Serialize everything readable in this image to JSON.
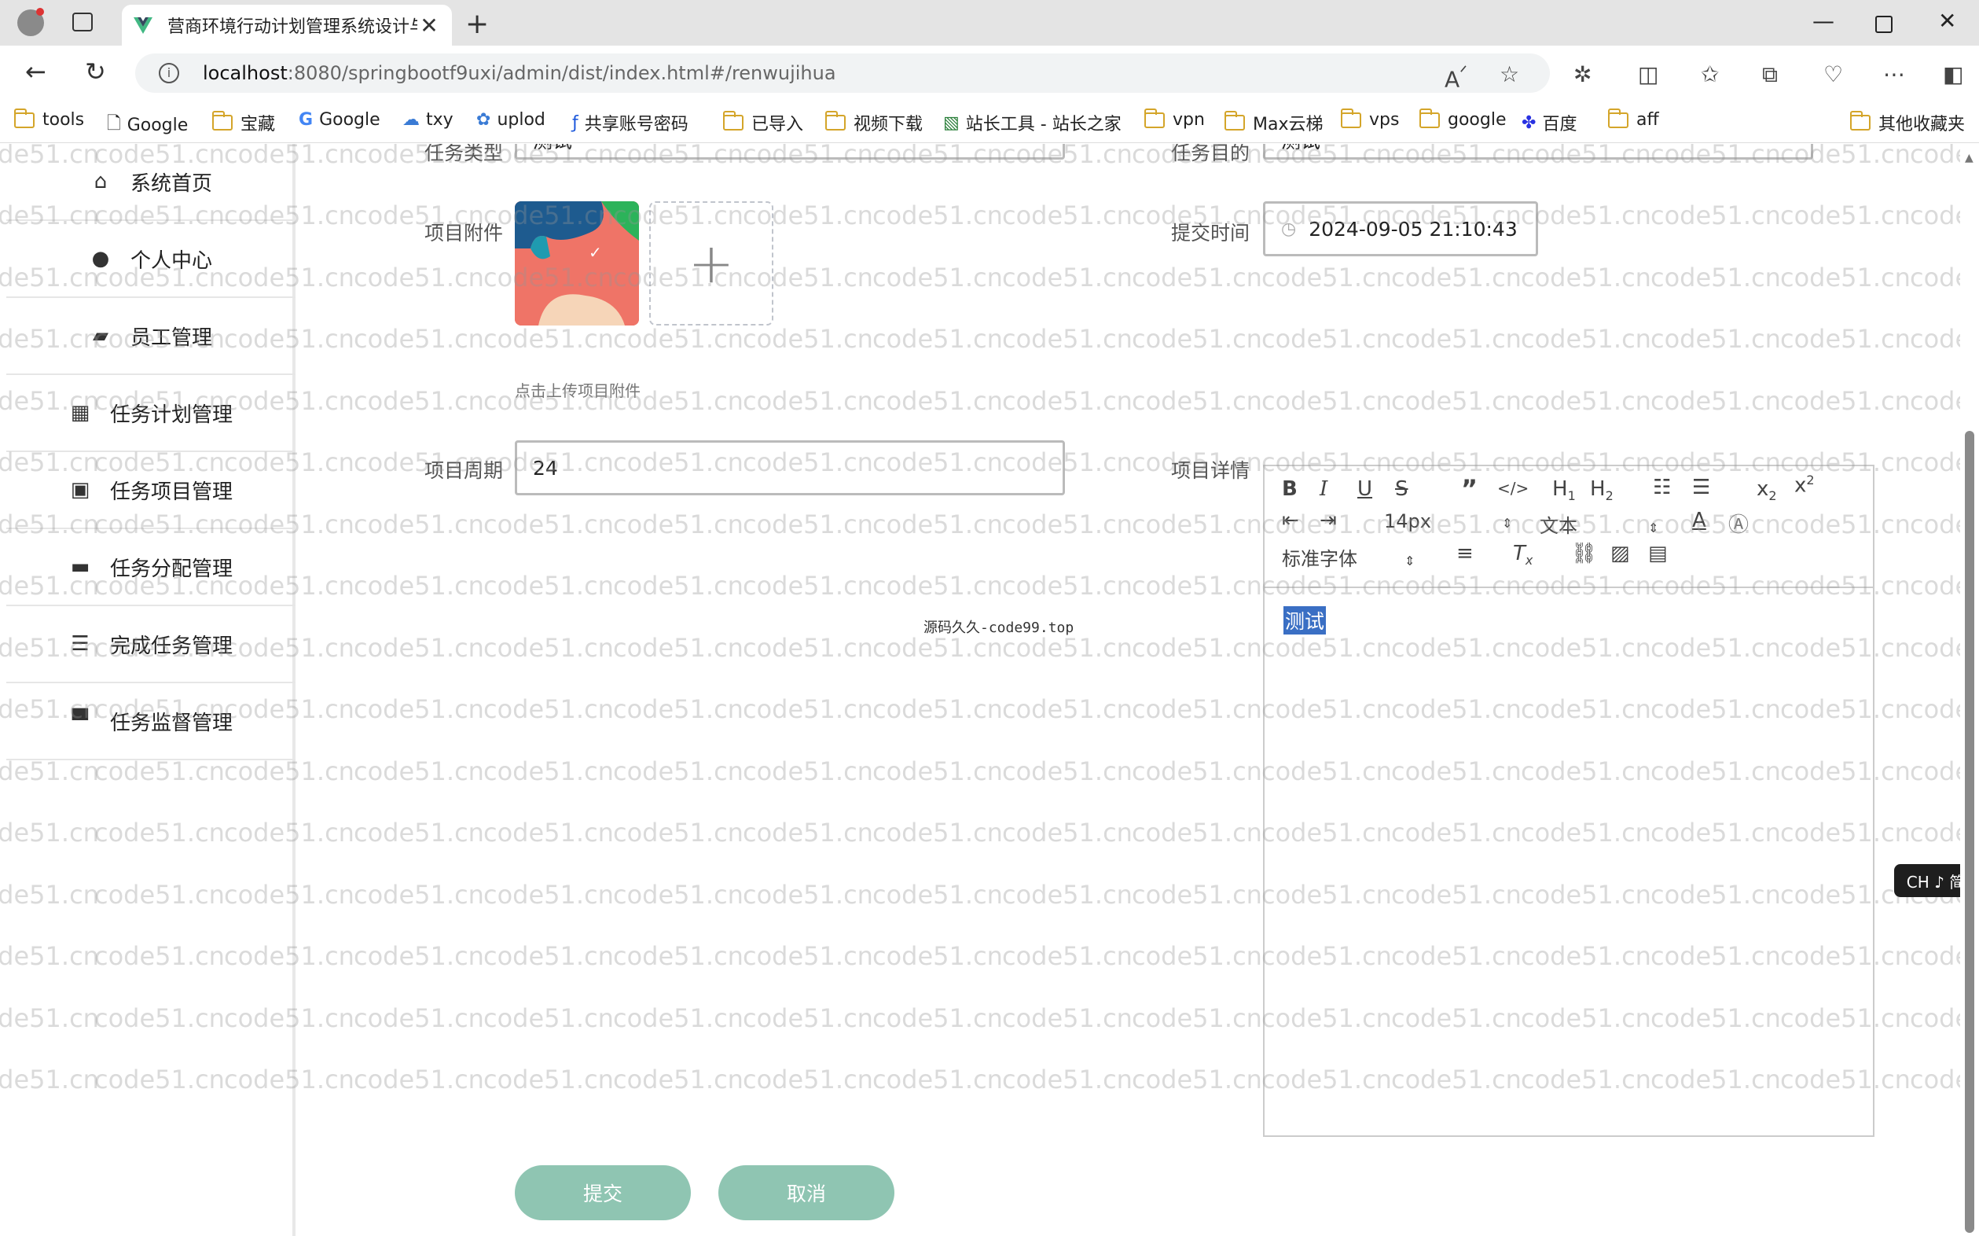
{
  "browser": {
    "tab_title": "营商环境行动计划管理系统设计与",
    "new_tab_icon": "plus-icon",
    "url_host": "localhost",
    "url_path": ":8080/springbootf9uxi/admin/dist/index.html#/renwujihua",
    "bookmarks": [
      {
        "label": "tools",
        "icon": "folder-icon"
      },
      {
        "label": "Google",
        "icon": "page-icon"
      },
      {
        "label": "宝藏",
        "icon": "folder-icon"
      },
      {
        "label": "Google",
        "icon": "google-icon"
      },
      {
        "label": "txy",
        "icon": "cloud-icon"
      },
      {
        "label": "uplod",
        "icon": "upload-icon"
      },
      {
        "label": "共享账号密码",
        "icon": "share-icon"
      },
      {
        "label": "已导入",
        "icon": "folder-icon"
      },
      {
        "label": "视频下载",
        "icon": "folder-icon"
      },
      {
        "label": "站长工具 - 站长之家",
        "icon": "chart-icon"
      },
      {
        "label": "vpn",
        "icon": "folder-icon"
      },
      {
        "label": "Max云梯",
        "icon": "folder-icon"
      },
      {
        "label": "vps",
        "icon": "folder-icon"
      },
      {
        "label": "google",
        "icon": "folder-icon"
      },
      {
        "label": "百度",
        "icon": "baidu-icon"
      },
      {
        "label": "aff",
        "icon": "folder-icon"
      }
    ],
    "other_bookmarks": "其他收藏夹"
  },
  "sidebar": {
    "items": [
      {
        "label": "系统首页",
        "icon": "home-icon"
      },
      {
        "label": "个人中心",
        "icon": "user-icon"
      },
      {
        "label": "员工管理",
        "icon": "wallet-icon"
      },
      {
        "label": "任务计划管理",
        "icon": "grid-icon"
      },
      {
        "label": "任务项目管理",
        "icon": "clipboard-icon"
      },
      {
        "label": "任务分配管理",
        "icon": "chat-icon"
      },
      {
        "label": "完成任务管理",
        "icon": "list-icon"
      },
      {
        "label": "任务监督管理",
        "icon": "monitor-icon"
      }
    ]
  },
  "form": {
    "task_type_label": "任务类型",
    "task_type_value": "测试",
    "task_goal_label": "任务目的",
    "task_goal_value": "测试",
    "attachment_label": "项目附件",
    "attachment_hint": "点击上传项目附件",
    "submit_time_label": "提交时间",
    "submit_time_value": "2024-09-05 21:10:43",
    "cycle_label": "项目周期",
    "cycle_value": "24",
    "detail_label": "项目详情",
    "editor": {
      "font_size": "14px",
      "heading": "文本",
      "font_family": "标准字体",
      "content": "测试"
    },
    "submit_button": "提交",
    "cancel_button": "取消"
  },
  "center_text": "源码久久-code99.top",
  "ime_indicator": "CH ♪ 简",
  "watermark": "code51.cn"
}
